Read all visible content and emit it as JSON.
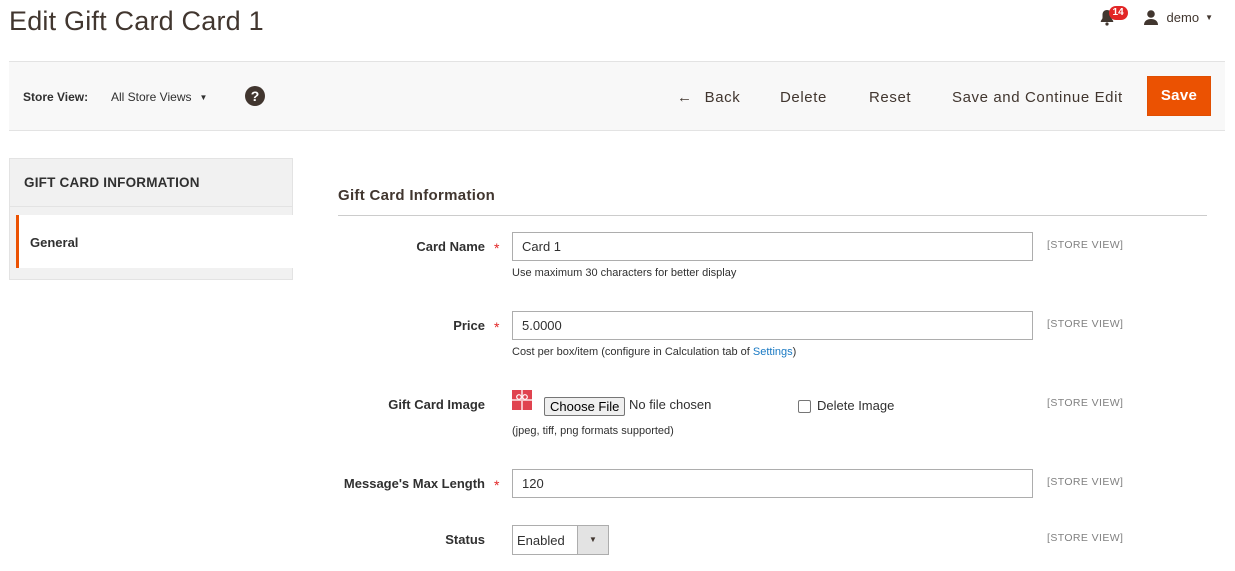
{
  "page": {
    "title": "Edit Gift Card Card 1"
  },
  "header": {
    "notification_count": "14",
    "user_name": "demo"
  },
  "action_bar": {
    "store_view_label": "Store View:",
    "store_view_value": "All Store Views",
    "help_glyph": "?",
    "back_label": "Back",
    "delete_label": "Delete",
    "reset_label": "Reset",
    "save_continue_label": "Save and Continue Edit",
    "save_label": "Save"
  },
  "sidebar": {
    "header": "GIFT CARD INFORMATION",
    "items": [
      {
        "label": "General",
        "active": true
      }
    ]
  },
  "form": {
    "section_title": "Gift Card Information",
    "scope_label": "[STORE VIEW]",
    "required_marker": "*",
    "fields": {
      "card_name": {
        "label": "Card Name",
        "value": "Card 1",
        "note": "Use maximum 30 characters for better display"
      },
      "price": {
        "label": "Price",
        "value": "5.0000",
        "note_prefix": "Cost per box/item (configure in Calculation tab of ",
        "note_link": "Settings",
        "note_suffix": ")"
      },
      "image": {
        "label": "Gift Card Image",
        "choose_button": "Choose File",
        "no_file": "No file chosen",
        "delete_label": "Delete Image",
        "note": "(jpeg, tiff, png formats supported)"
      },
      "max_length": {
        "label": "Message's Max Length",
        "value": "120"
      },
      "status": {
        "label": "Status",
        "value": "Enabled"
      }
    }
  },
  "colors": {
    "accent": "#eb5202",
    "required": "#e22626",
    "link": "#1979c3",
    "badge": "#e22626"
  }
}
